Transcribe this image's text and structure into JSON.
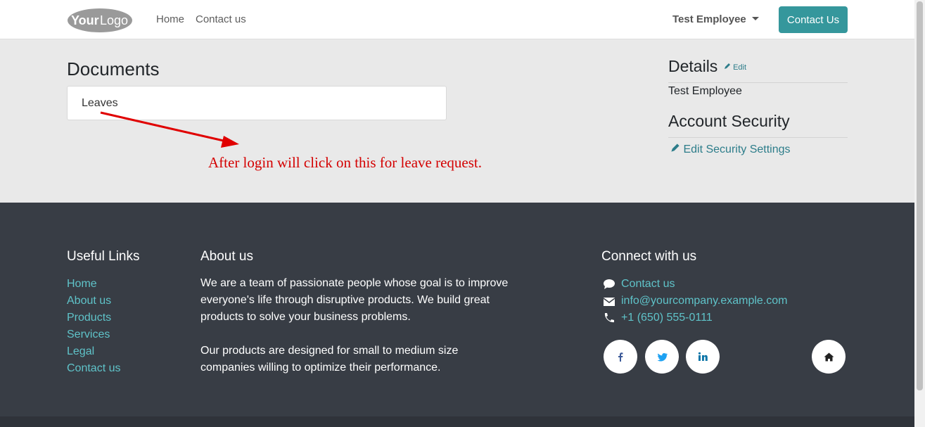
{
  "header": {
    "logo_text": "YourLogo",
    "nav": [
      {
        "label": "Home"
      },
      {
        "label": "Contact us"
      }
    ],
    "user_name": "Test Employee",
    "cta_label": "Contact Us"
  },
  "main": {
    "documents_title": "Documents",
    "documents": [
      {
        "label": "Leaves"
      }
    ],
    "annotation": "After login will click on this for leave request."
  },
  "sidebar": {
    "details_title": "Details",
    "edit_label": "Edit",
    "employee_name": "Test Employee",
    "security_title": "Account Security",
    "edit_security_label": "Edit Security Settings"
  },
  "footer": {
    "useful_links_title": "Useful Links",
    "useful_links": [
      {
        "label": "Home"
      },
      {
        "label": "About us"
      },
      {
        "label": "Products"
      },
      {
        "label": "Services"
      },
      {
        "label": "Legal"
      },
      {
        "label": "Contact us"
      }
    ],
    "about_title": "About us",
    "about_p1": [
      "We are a team of passionate people whose goal is to improve",
      "everyone's life through disruptive products. We build great",
      "products to solve your business problems."
    ],
    "about_p2": [
      "Our products are designed for small to medium size",
      "companies willing to optimize their performance."
    ],
    "connect_title": "Connect with us",
    "contacts": [
      {
        "icon": "comment-icon",
        "label": "Contact us"
      },
      {
        "icon": "envelope-icon",
        "label": "info@yourcompany.example.com"
      },
      {
        "icon": "phone-icon",
        "label": "+1 (650) 555-0111"
      }
    ],
    "social": [
      "facebook-icon",
      "twitter-icon",
      "linkedin-icon",
      "home-icon"
    ]
  },
  "colors": {
    "accent": "#35979c",
    "link": "#5fc3c9",
    "footer_bg": "#383d45",
    "annotation": "#d40000"
  }
}
